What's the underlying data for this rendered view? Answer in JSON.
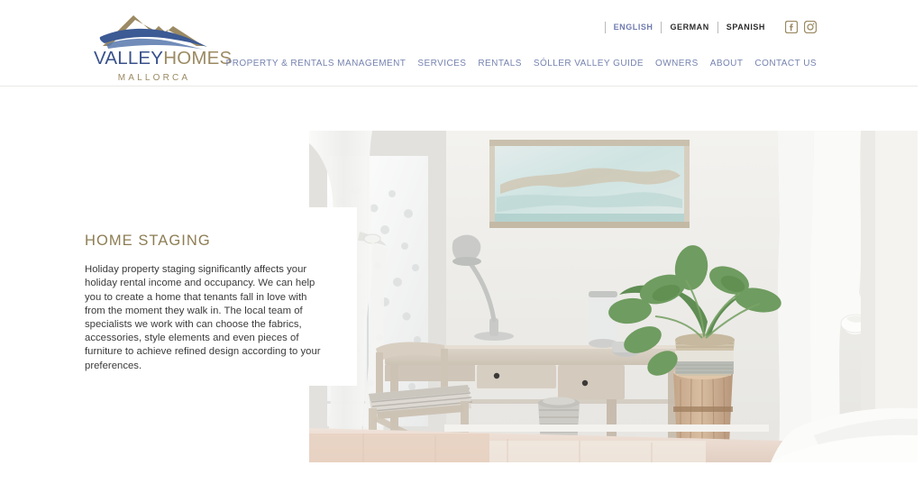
{
  "site": {
    "logo": {
      "mark_icon": "mountain-wave-icon",
      "word_primary": "VALLEY",
      "word_secondary": "HOMES",
      "subtitle": "MALLORCA",
      "color_primary": "#39518b",
      "color_secondary": "#9b8a63"
    }
  },
  "utility": {
    "languages": [
      {
        "label": "ENGLISH",
        "active": true
      },
      {
        "label": "GERMAN",
        "active": false
      },
      {
        "label": "SPANISH",
        "active": false
      }
    ],
    "social": [
      {
        "icon": "facebook-icon",
        "name": "Facebook"
      },
      {
        "icon": "instagram-icon",
        "name": "Instagram"
      }
    ],
    "social_color": "#9b8a63",
    "active_language_color": "#6f7bb0"
  },
  "nav": {
    "color": "#7683b0",
    "items": [
      {
        "label": "PROPERTY & RENTALS MANAGEMENT"
      },
      {
        "label": "SERVICES"
      },
      {
        "label": "RENTALS"
      },
      {
        "label": "SÓLLER VALLEY GUIDE"
      },
      {
        "label": "OWNERS"
      },
      {
        "label": "ABOUT"
      },
      {
        "label": "CONTACT US"
      }
    ]
  },
  "main": {
    "title": "HOME STAGING",
    "title_color": "#8d7d54",
    "body": "Holiday property staging significantly affects your holiday rental income and occupancy. We can help you to create a home that tenants fall in love with from the moment they walk in. The local team of specialists we work with can choose the fabrics, accessories, style elements and even pieces of furniture to achieve refined design according to your preferences.",
    "photo_alt": "Bright white bedroom interior with whitewashed wooden desk, chair with striped cushion, desk lamp, framed map artwork, potted plant on wood stump and sheer curtains"
  }
}
